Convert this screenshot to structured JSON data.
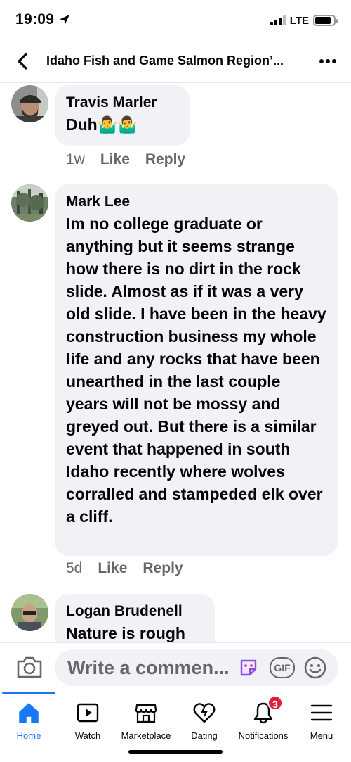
{
  "status_bar": {
    "time": "19:09",
    "network": "LTE"
  },
  "header": {
    "title": "Idaho Fish and Game Salmon Region’..."
  },
  "comments": [
    {
      "author": "Travis Marler",
      "text": "Duh🤷‍♂️🤷‍♂️",
      "time": "1w",
      "like": "Like",
      "reply": "Reply"
    },
    {
      "author": "Mark Lee",
      "text": "Im no college graduate or anything but it seems strange how there is no dirt in the rock slide. Almost as if it was a very old slide. I have been in the heavy construction business my whole life and any rocks that have been unearthed in the last couple years will not be mossy and greyed out. But there is a similar event that happened in south Idaho recently where wolves corralled  and stampeded elk over a cliff.",
      "time": "5d",
      "like": "Like",
      "reply": "Reply"
    },
    {
      "author": "Logan Brudenell",
      "text": "Nature is rough"
    }
  ],
  "composer": {
    "placeholder": "Write a commen...",
    "gif_label": "GIF"
  },
  "tabs": [
    {
      "label": "Home",
      "icon": "home-icon",
      "active": true
    },
    {
      "label": "Watch",
      "icon": "watch-icon"
    },
    {
      "label": "Marketplace",
      "icon": "marketplace-icon"
    },
    {
      "label": "Dating",
      "icon": "dating-icon"
    },
    {
      "label": "Notifications",
      "icon": "bell-icon",
      "badge": "3"
    },
    {
      "label": "Menu",
      "icon": "menu-icon"
    }
  ],
  "colors": {
    "accent": "#1877f2",
    "bubble": "#f0f2f5",
    "muted": "#65676b",
    "badge": "#e41e3f"
  }
}
